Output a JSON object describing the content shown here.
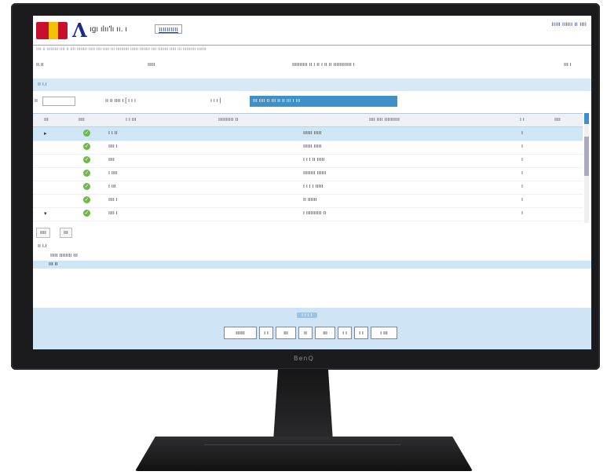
{
  "monitor": {
    "brand": "BenQ"
  },
  "header": {
    "logo_text": "ıgı ılıı'lı ıı. ı",
    "logo_link": "ıııııııııı",
    "user": "ııııı ıııııı ıı ıııı"
  },
  "subheader": "ıııı ıı ııııııııı ıııı ıı ıııı ıııııııı ııııı ıııı ııııı ııı ıııııııııı ıııııı ıııııııı ıııı ıııııııı ııııı ııı ıııııııııı ııııııı",
  "info": {
    "left": "ıı.ıı",
    "mid": "ııııı",
    "right": "ıııııııııı ıı ı ıı ı ıı ıı ıııııııııııı ı",
    "far": "ııı ı"
  },
  "section_title": "ıı ı.ı",
  "toolbar": {
    "label": "ıı",
    "text1": "ıı ıı ıııı ı [ ı ı ı",
    "text2": "ı ı ı |",
    "blue_button": "ııı ıııı ıı ııı ıı ıı ııı ı ııı"
  },
  "grid": {
    "columns": [
      "ııı",
      "ıııı",
      "ı ı ııı",
      "ıııııııııı ıı",
      "ıııı ıııı ıııııııııı",
      "ı ı",
      "ıııı"
    ],
    "rows": [
      {
        "c1": "ı ı ıı",
        "c2": "ıııııı ııııı",
        "c3": "ı",
        "selected": true
      },
      {
        "c1": "ıııı ı",
        "c2": "ıııııı ııııı",
        "c3": "ı",
        "selected": false
      },
      {
        "c1": "ıııı",
        "c2": "ı ı ı ıı ııııı",
        "c3": "ı",
        "selected": false
      },
      {
        "c1": "ı ıııı",
        "c2": "ıııııııı ıııııı",
        "c3": "ı",
        "selected": false
      },
      {
        "c1": "ı ııı",
        "c2": "ı ı ı ı ııııı",
        "c3": "ı",
        "selected": false
      },
      {
        "c1": "ıııı ı",
        "c2": "ıı ıııııı",
        "c3": "ı",
        "selected": false
      },
      {
        "c1": "ıııı ı",
        "c2": "ı ıııııııııı ıı",
        "c3": "ı",
        "selected": false
      }
    ]
  },
  "tabs": [
    "ıııı",
    "ııı"
  ],
  "detail": {
    "line1": "ıı ı.ı",
    "line2": "ııııı ıııııııı ııı",
    "selected": "ııı ıı"
  },
  "footer": {
    "pager": "ı ı ı ı",
    "buttons": [
      "ıııııı",
      "ı ı",
      "ııı",
      "ıı",
      "ııı",
      "ı ı",
      "ı ı",
      "ı ııı"
    ]
  }
}
